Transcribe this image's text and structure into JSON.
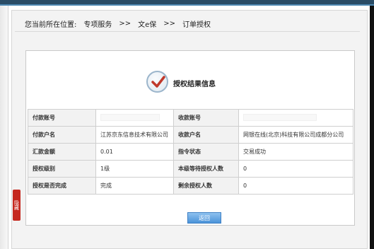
{
  "breadcrumb": {
    "label": "您当前所在位置:",
    "item1": "专项服务",
    "sep1": ">>",
    "item2": "文e保",
    "sep2": ">>",
    "item3": "订单授权"
  },
  "result": {
    "title": "授权结果信息"
  },
  "table": {
    "rows": [
      {
        "label1": "付款账号",
        "value1": "",
        "label2": "收款账号",
        "value2": ""
      },
      {
        "label1": "付款户名",
        "value1": "江苏京东信息技术有限公司",
        "label2": "收款户名",
        "value2": "网银在线(北京)科技有限公司成都分公司"
      },
      {
        "label1": "汇款金额",
        "value1": "0.01",
        "label2": "指令状态",
        "value2": "交易成功"
      },
      {
        "label1": "授权级别",
        "value1": "1级",
        "label2": "本级等待授权人数",
        "value2": "0"
      },
      {
        "label1": "授权是否完成",
        "value1": "完成",
        "label2": "剩余授权人数",
        "value2": "0"
      }
    ]
  },
  "actions": {
    "return_label": "返回"
  },
  "side_tab": {
    "label": "隐藏"
  },
  "colors": {
    "topbar": "#2a4c66",
    "button": "#4b93d9",
    "side_tab": "#c5281f"
  }
}
